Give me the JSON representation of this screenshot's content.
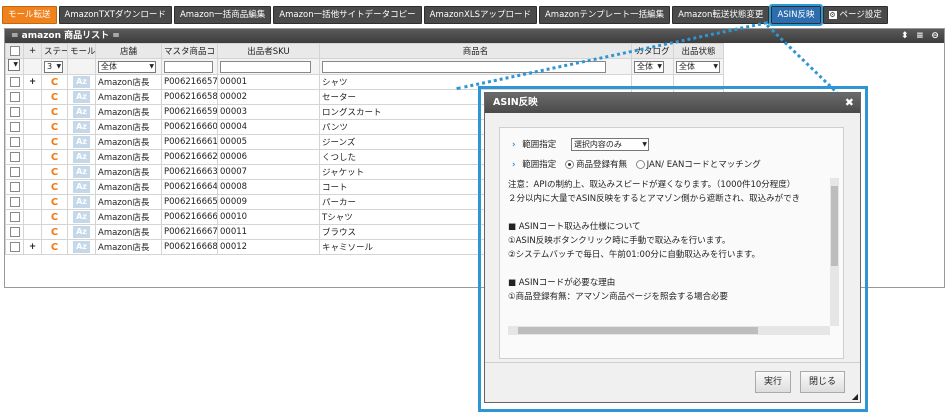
{
  "toolbar": {
    "items": [
      {
        "label": "モール転送"
      },
      {
        "label": "AmazonTXTダウンロード"
      },
      {
        "label": "Amazon一括商品編集"
      },
      {
        "label": "Amazon一括他サイトデータコピー"
      },
      {
        "label": "AmazonXLSアップロード"
      },
      {
        "label": "Amazonテンプレート一括編集"
      },
      {
        "label": "Amazon転送状態変更"
      },
      {
        "label": "ASIN反映"
      },
      {
        "label": "ページ設定"
      }
    ]
  },
  "panel": {
    "title": "= amazon 商品リスト ="
  },
  "columns": [
    "ステー",
    "モール",
    "店舗",
    "マスタ商品コ",
    "出品者SKU",
    "商品名",
    "カタログ",
    "出品状態"
  ],
  "filters": {
    "status": "3",
    "store": "全体",
    "catalog": "全体",
    "listing": "全体"
  },
  "rows": [
    {
      "plus": "+",
      "store": "Amazon店長",
      "code": "P006216657",
      "sku": "00001",
      "name": "シャツ"
    },
    {
      "plus": "",
      "store": "Amazon店長",
      "code": "P006216658",
      "sku": "00002",
      "name": "セーター"
    },
    {
      "plus": "",
      "store": "Amazon店長",
      "code": "P006216659",
      "sku": "00003",
      "name": "ロングスカート"
    },
    {
      "plus": "",
      "store": "Amazon店長",
      "code": "P006216660",
      "sku": "00004",
      "name": "パンツ"
    },
    {
      "plus": "",
      "store": "Amazon店長",
      "code": "P006216661",
      "sku": "00005",
      "name": "ジーンズ"
    },
    {
      "plus": "",
      "store": "Amazon店長",
      "code": "P006216662",
      "sku": "00006",
      "name": "くつした"
    },
    {
      "plus": "",
      "store": "Amazon店長",
      "code": "P006216663",
      "sku": "00007",
      "name": "ジャケット"
    },
    {
      "plus": "",
      "store": "Amazon店長",
      "code": "P006216664",
      "sku": "00008",
      "name": "コート"
    },
    {
      "plus": "",
      "store": "Amazon店長",
      "code": "P006216665",
      "sku": "00009",
      "name": "パーカー"
    },
    {
      "plus": "",
      "store": "Amazon店長",
      "code": "P006216666",
      "sku": "00010",
      "name": "Tシャツ"
    },
    {
      "plus": "",
      "store": "Amazon店長",
      "code": "P006216667",
      "sku": "00011",
      "name": "ブラウス"
    },
    {
      "plus": "+",
      "store": "Amazon店長",
      "code": "P006216668",
      "sku": "00012",
      "name": "キャミソール"
    }
  ],
  "row_icons": {
    "mall": "C",
    "az": "Az"
  },
  "dialog": {
    "title": "ASIN反映",
    "range_label": "範囲指定",
    "range_value": "選択内容のみ",
    "range2_label": "範囲指定",
    "radio1": "商品登録有無",
    "radio2": "JAN/ EANコードとマッチング",
    "notice": [
      "注意：APIの制約上、取込みスピードが遅くなります。（1000件10分程度）",
      "２分以内に大量でASIN反映をするとアマゾン側から遮断され、取込みができ",
      "",
      "■ ASINコート取込み仕様について",
      "①ASIN反映ボタンクリック時に手動で取込みを行います。",
      "②システムバッチで毎日、午前01:00分に自動取込みを行います。",
      "",
      "■ ASINコードが必要な理由",
      "①商品登録有無：アマゾン商品ページを照会する場合必要"
    ],
    "execute": "実行",
    "close": "閉じる"
  },
  "colors": {
    "accent": "#2e96d3",
    "orange": "#f0821e"
  }
}
